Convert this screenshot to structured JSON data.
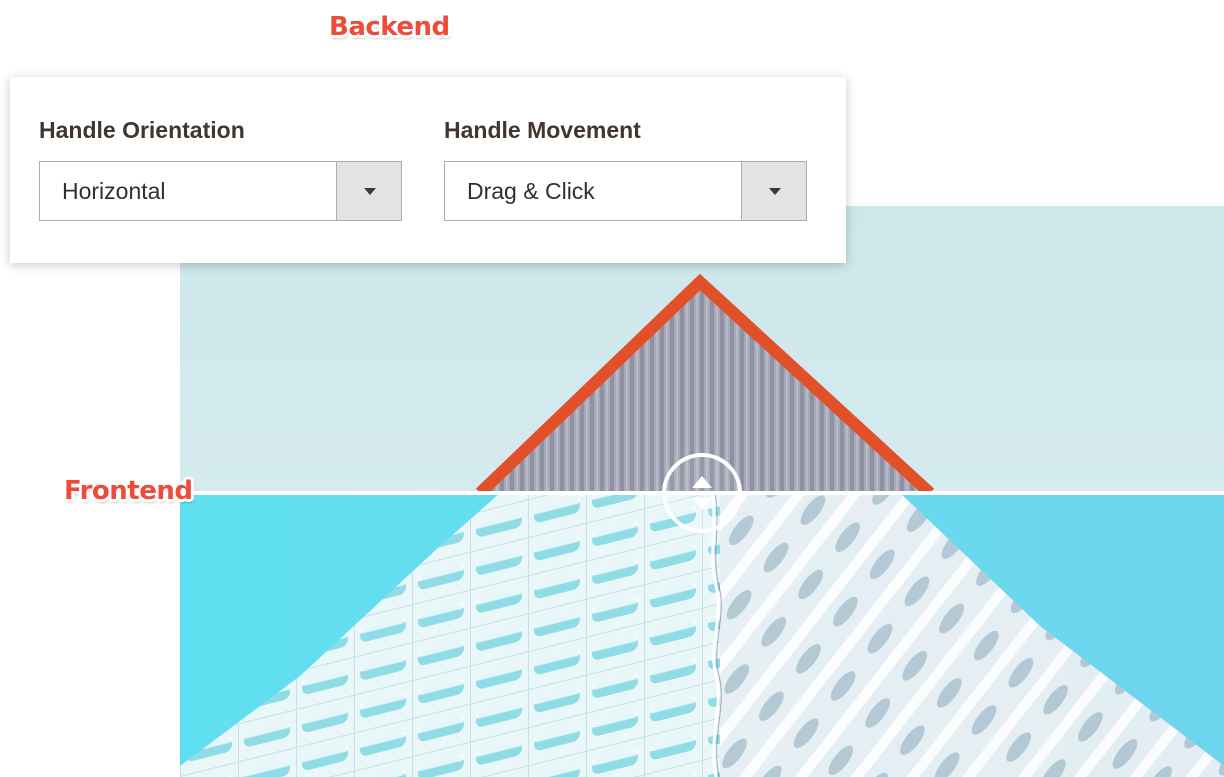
{
  "labels": {
    "backend": "Backend",
    "frontend": "Frontend"
  },
  "settings": {
    "orientation": {
      "label": "Handle Orientation",
      "value": "Horizontal"
    },
    "movement": {
      "label": "Handle Movement",
      "value": "Drag & Click"
    }
  },
  "icons": {
    "select_arrow": "chevron-down-icon",
    "handle": "drag-handle-icon"
  },
  "colors": {
    "sticker_red": "#ee4b3a",
    "sky_top": "#cfe8ec",
    "sky_bottom": "#6edff2",
    "roof_edge": "#e2502a",
    "divider": "#ffffff"
  }
}
